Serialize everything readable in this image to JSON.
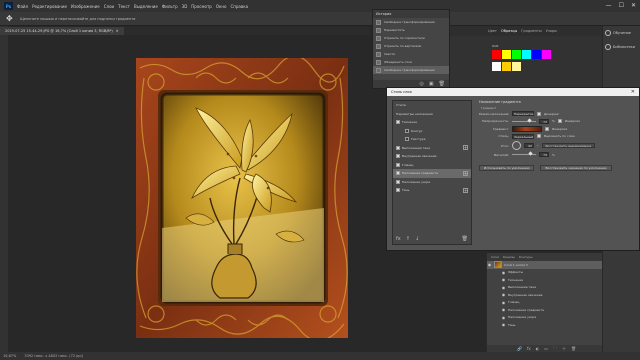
{
  "menubar": {
    "logo": "Ps",
    "items": [
      "Файл",
      "Редактирование",
      "Изображение",
      "Слои",
      "Текст",
      "Выделение",
      "Фильтр",
      "3D",
      "Просмотр",
      "Окно",
      "Справка"
    ],
    "window_controls": [
      "—",
      "☐",
      "✕"
    ]
  },
  "options": {
    "move_icon": "✥",
    "hint": "Щелкните мышью и перетаскивайте для подгонки градиента"
  },
  "document": {
    "tab_label": "2019-07-25 15-44-29.JPG @ 16,7% (Слой 1 копия 3, RGB/8*)",
    "tab_close": "✕"
  },
  "status": {
    "zoom": "16,67%",
    "doc_info": "3392 пикс. x 4802 пикс. (72 ppi)"
  },
  "history": {
    "title": "История",
    "items": [
      "Свободное трансформирование",
      "Переместить",
      "Отразить по горизонтали",
      "Отразить по вертикали",
      "Свести",
      "Объединить слои",
      "Свободное трансформирование"
    ],
    "selected_index": 6
  },
  "dock": {
    "tabs": [
      "Цвет",
      "Образцы",
      "Градиенты",
      "Узоры"
    ],
    "active_tab": "Образцы",
    "swatch_group": "RGB",
    "swatch_colors": [
      "#ff0000",
      "#ffff00",
      "#00ff00",
      "#00ffff",
      "#0000ff",
      "#ff00ff",
      "#ffffff",
      "#ffcc00",
      "#fff799"
    ]
  },
  "right_strip": {
    "items": [
      {
        "label": "Обучение",
        "icon": "bulb-icon"
      },
      {
        "label": "Библиотеки",
        "icon": "library-icon"
      }
    ]
  },
  "layer_style_dialog": {
    "title": "Стиль слоя",
    "close": "✕",
    "styles": [
      {
        "label": "Стили",
        "checkbox": false,
        "plus": false,
        "header": true
      },
      {
        "label": "Параметры наложения",
        "checkbox": false,
        "plus": false,
        "header": true
      },
      {
        "label": "Тиснение",
        "checkbox": true,
        "checked": true,
        "plus": false
      },
      {
        "label": "Контур",
        "checkbox": true,
        "checked": false,
        "plus": false,
        "sub": true
      },
      {
        "label": "Текстура",
        "checkbox": true,
        "checked": false,
        "plus": false,
        "sub": true
      },
      {
        "label": "Выполнение тени",
        "checkbox": true,
        "checked": true,
        "plus": true
      },
      {
        "label": "Внутреннее свечение",
        "checkbox": true,
        "checked": true,
        "plus": false
      },
      {
        "label": "Глянец",
        "checkbox": true,
        "checked": true,
        "plus": false
      },
      {
        "label": "Наложение градиента",
        "checkbox": true,
        "checked": true,
        "plus": true,
        "selected": true
      },
      {
        "label": "Наложение узора",
        "checkbox": true,
        "checked": true,
        "plus": false
      },
      {
        "label": "Тень",
        "checkbox": true,
        "checked": true,
        "plus": true
      }
    ],
    "bottom_icons": [
      "fx",
      "↑",
      "↓",
      "🗑"
    ],
    "gradient_overlay": {
      "title": "Наложение градиента",
      "subtitle": "Градиент",
      "rows": {
        "blend_mode": {
          "label": "Режим наложения:",
          "value": "Перекрытие",
          "option": "Дизеринг"
        },
        "opacity": {
          "label": "Непрозрачность:",
          "value": "72",
          "unit": "%",
          "option": "Инверсия",
          "level": 0.72
        },
        "gradient": {
          "label": "Градиент:",
          "option": "Инверсия"
        },
        "style": {
          "label": "Стиль:",
          "value": "Зеркальный",
          "option": "Выровнять по слою"
        },
        "angle": {
          "label": "Угол:",
          "value": "90",
          "unit": "°",
          "button": "Восстановить выравнивание"
        },
        "scale": {
          "label": "Масштаб:",
          "value": "79",
          "unit": "%",
          "level": 0.79
        }
      },
      "buttons": [
        "Использовать по умолчанию",
        "Восстановить значения по умолчанию"
      ]
    }
  },
  "layers": {
    "tabs": [
      "Слои",
      "Каналы",
      "Контуры"
    ],
    "items": [
      {
        "label": "Слой 1 копия 3",
        "selected": true,
        "thumb": true
      },
      {
        "label": "Эффекты",
        "fx": true
      },
      {
        "label": "Тиснение",
        "fx": true
      },
      {
        "label": "Выполнение тени",
        "fx": true
      },
      {
        "label": "Внутреннее свечение",
        "fx": true
      },
      {
        "label": "Глянец",
        "fx": true
      },
      {
        "label": "Наложение градиента",
        "fx": true
      },
      {
        "label": "Наложение узора",
        "fx": true
      },
      {
        "label": "Тень",
        "fx": true
      }
    ],
    "footer_icons": [
      "🔗",
      "fx",
      "◐",
      "▭",
      "🗀",
      "＋",
      "🗑"
    ]
  }
}
